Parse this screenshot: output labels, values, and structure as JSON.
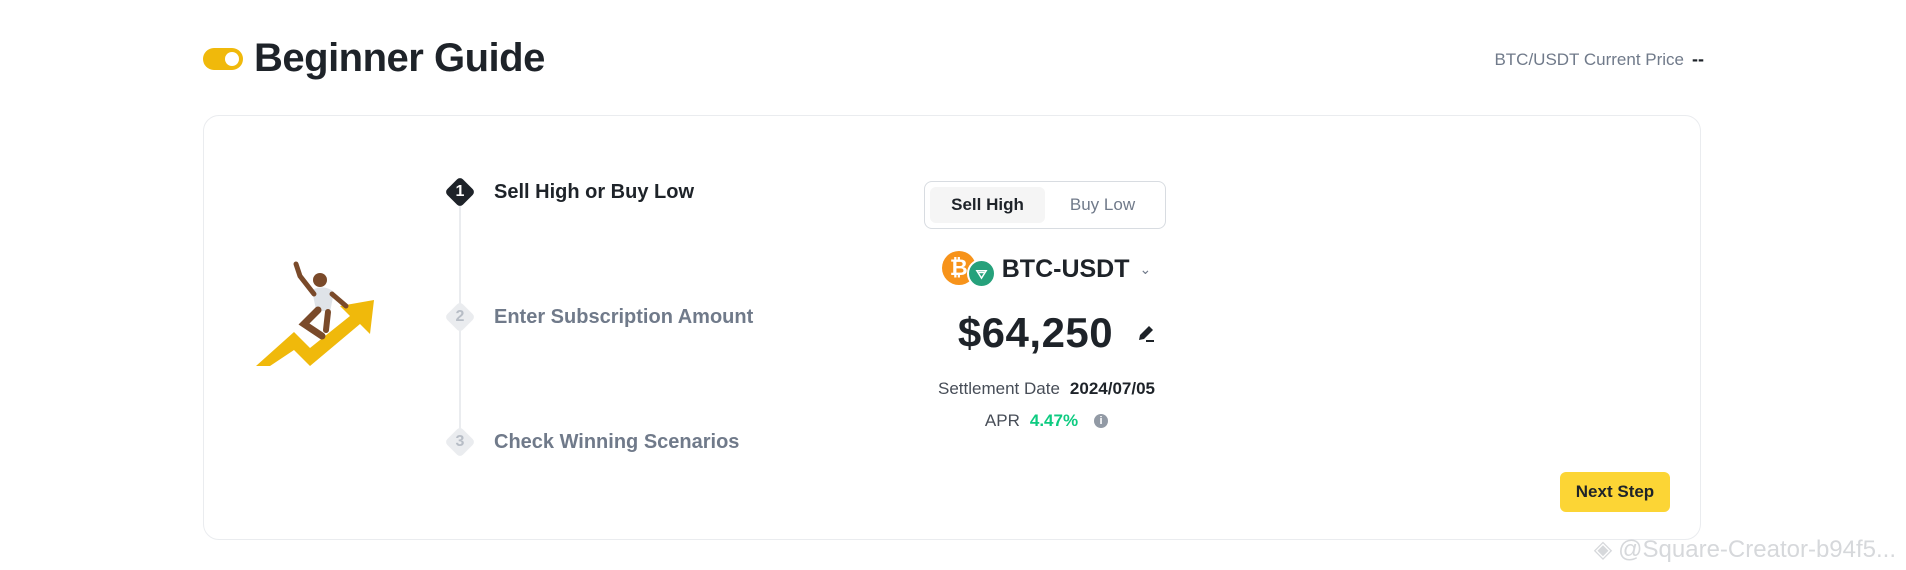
{
  "header": {
    "title": "Beginner Guide",
    "price_label": "BTC/USDT Current Price",
    "price_value": "--"
  },
  "steps": [
    {
      "number": "1",
      "label": "Sell High or Buy Low",
      "active": true
    },
    {
      "number": "2",
      "label": "Enter Subscription Amount",
      "active": false
    },
    {
      "number": "3",
      "label": "Check Winning Scenarios",
      "active": false
    }
  ],
  "direction": {
    "options": [
      "Sell High",
      "Buy Low"
    ],
    "selected": "Sell High"
  },
  "pair": {
    "name": "BTC-USDT",
    "base_icon": "bitcoin-icon",
    "quote_icon": "tether-icon"
  },
  "strike_price": "$64,250",
  "settlement": {
    "label": "Settlement Date",
    "value": "2024/07/05"
  },
  "apr": {
    "label": "APR",
    "value": "4.47%"
  },
  "next_button": "Next Step",
  "watermark": "@Square-Creator-b94f5...",
  "colors": {
    "accent": "#fcd535",
    "brand": "#f0b90b",
    "positive": "#0ecb81",
    "text": "#1e2329",
    "muted": "#707a8a"
  }
}
